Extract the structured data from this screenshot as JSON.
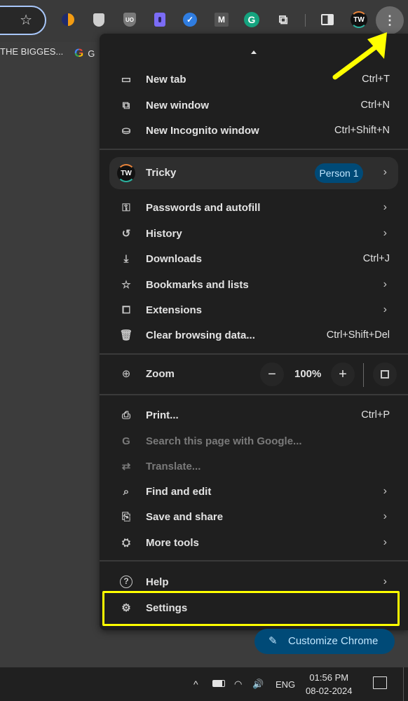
{
  "toolbar": {
    "bookmark_star_icon": "star-icon",
    "extensions": [
      {
        "name": "orange-blue-extension-icon",
        "glyph": ""
      },
      {
        "name": "shield-extension-icon",
        "glyph": ""
      },
      {
        "name": "ublock-origin-icon",
        "glyph": "UO"
      },
      {
        "name": "purple-doc-extension-icon",
        "glyph": ""
      },
      {
        "name": "blue-check-extension-icon",
        "glyph": "✓"
      },
      {
        "name": "m-extension-icon",
        "glyph": "M"
      },
      {
        "name": "grammarly-icon",
        "glyph": "G"
      },
      {
        "name": "extensions-puzzle-icon",
        "glyph": "⧉"
      }
    ],
    "side_panel_icon": "side-panel-icon",
    "profile_initials": "TW",
    "menu_glyph": "⋮"
  },
  "bookmarks": [
    {
      "label": "THE BIGGES..."
    },
    {
      "label": "G",
      "icon": "G"
    }
  ],
  "menu": {
    "group1": [
      {
        "icon": "▭",
        "label": "New tab",
        "shortcut": "Ctrl+T"
      },
      {
        "icon": "⧉",
        "label": "New window",
        "shortcut": "Ctrl+N"
      },
      {
        "icon": "⛀",
        "label": "New Incognito window",
        "shortcut": "Ctrl+Shift+N"
      }
    ],
    "profile": {
      "initials": "TW",
      "name": "Tricky",
      "badge": "Person 1",
      "chevron": "›"
    },
    "group2": [
      {
        "icon": "⚿",
        "label": "Passwords and autofill",
        "shortcut": "",
        "chevron": "›"
      },
      {
        "icon": "↺",
        "label": "History",
        "shortcut": "",
        "chevron": "›"
      },
      {
        "icon": "⤓",
        "label": "Downloads",
        "shortcut": "Ctrl+J",
        "chevron": ""
      },
      {
        "icon": "☆",
        "label": "Bookmarks and lists",
        "shortcut": "",
        "chevron": "›"
      },
      {
        "icon": "⧠",
        "label": "Extensions",
        "shortcut": "",
        "chevron": "›"
      },
      {
        "icon": "🗑",
        "label": "Clear browsing data...",
        "shortcut": "Ctrl+Shift+Del",
        "chevron": ""
      }
    ],
    "zoom": {
      "icon": "⊕",
      "label": "Zoom",
      "minus": "−",
      "value": "100%",
      "plus": "+"
    },
    "group3": [
      {
        "icon": "⎙",
        "label": "Print...",
        "shortcut": "Ctrl+P",
        "chevron": "",
        "disabled": false
      },
      {
        "icon": "G",
        "label": "Search this page with Google...",
        "shortcut": "",
        "chevron": "",
        "disabled": true
      },
      {
        "icon": "⇄",
        "label": "Translate...",
        "shortcut": "",
        "chevron": "",
        "disabled": true
      },
      {
        "icon": "⌕",
        "label": "Find and edit",
        "shortcut": "",
        "chevron": "›",
        "disabled": false
      },
      {
        "icon": "⎘",
        "label": "Save and share",
        "shortcut": "",
        "chevron": "›",
        "disabled": false
      },
      {
        "icon": "⛭",
        "label": "More tools",
        "shortcut": "",
        "chevron": "›",
        "disabled": false
      }
    ],
    "group4": [
      {
        "icon": "?",
        "label": "Help",
        "shortcut": "",
        "chevron": "›"
      },
      {
        "icon": "⚙",
        "label": "Settings",
        "shortcut": "",
        "chevron": ""
      }
    ]
  },
  "customize_chrome": {
    "icon": "✎",
    "label": "Customize Chrome"
  },
  "annotation": {
    "highlight_color": "#ffff00",
    "highlight_target": "Settings"
  },
  "taskbar": {
    "tray_chevron": "^",
    "wifi_icon": "◠",
    "volume_icon": "🔊",
    "language": "ENG",
    "time": "01:56 PM",
    "date": "08-02-2024"
  },
  "colors": {
    "menu_bg": "#1f1f1f",
    "page_bg": "#3c3c3c",
    "badge_bg": "#004a77",
    "badge_text": "#c2e7ff",
    "omnibox_border": "#a8c7fa"
  }
}
